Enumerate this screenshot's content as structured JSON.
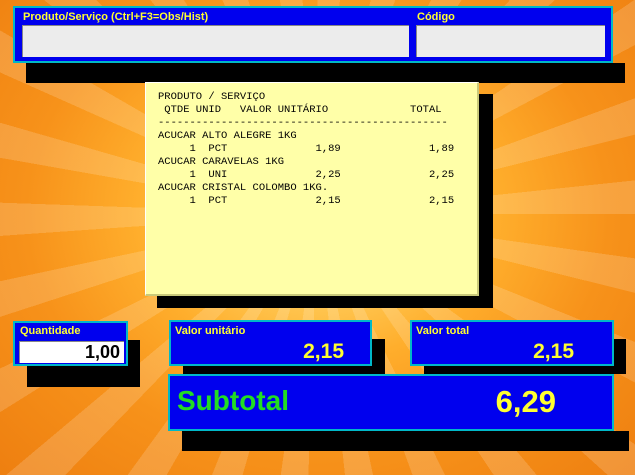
{
  "header": {
    "product_label": "Produto/Serviço (Ctrl+F3=Obs/Hist)",
    "product_value": "",
    "code_label": "Código",
    "code_value": ""
  },
  "receipt": {
    "header_line1": "PRODUTO / SERVIÇO",
    "header_line2": " QTDE UNID   VALOR UNITÁRIO             TOTAL",
    "separator": "----------------------------------------------",
    "items": [
      {
        "name": "ACUCAR ALTO ALEGRE 1KG",
        "detail": "     1  PCT              1,89              1,89"
      },
      {
        "name": "ACUCAR CARAVELAS 1KG",
        "detail": "     1  UNI              2,25              2,25"
      },
      {
        "name": "ACUCAR CRISTAL COLOMBO 1KG.",
        "detail": "     1  PCT              2,15              2,15"
      }
    ]
  },
  "quantity": {
    "label": "Quantidade",
    "value": "1,00"
  },
  "unit_value": {
    "label": "Valor unitário",
    "value": "2,15"
  },
  "total_value": {
    "label": "Valor total",
    "value": "2,15"
  },
  "subtotal": {
    "label": "Subtotal",
    "value": "6,29"
  },
  "colors": {
    "panel_blue": "#0000ee",
    "panel_border": "#00b8c8",
    "label_yellow": "#ffff30",
    "subtotal_green": "#22dd22",
    "receipt_bg": "#ffffa8"
  }
}
